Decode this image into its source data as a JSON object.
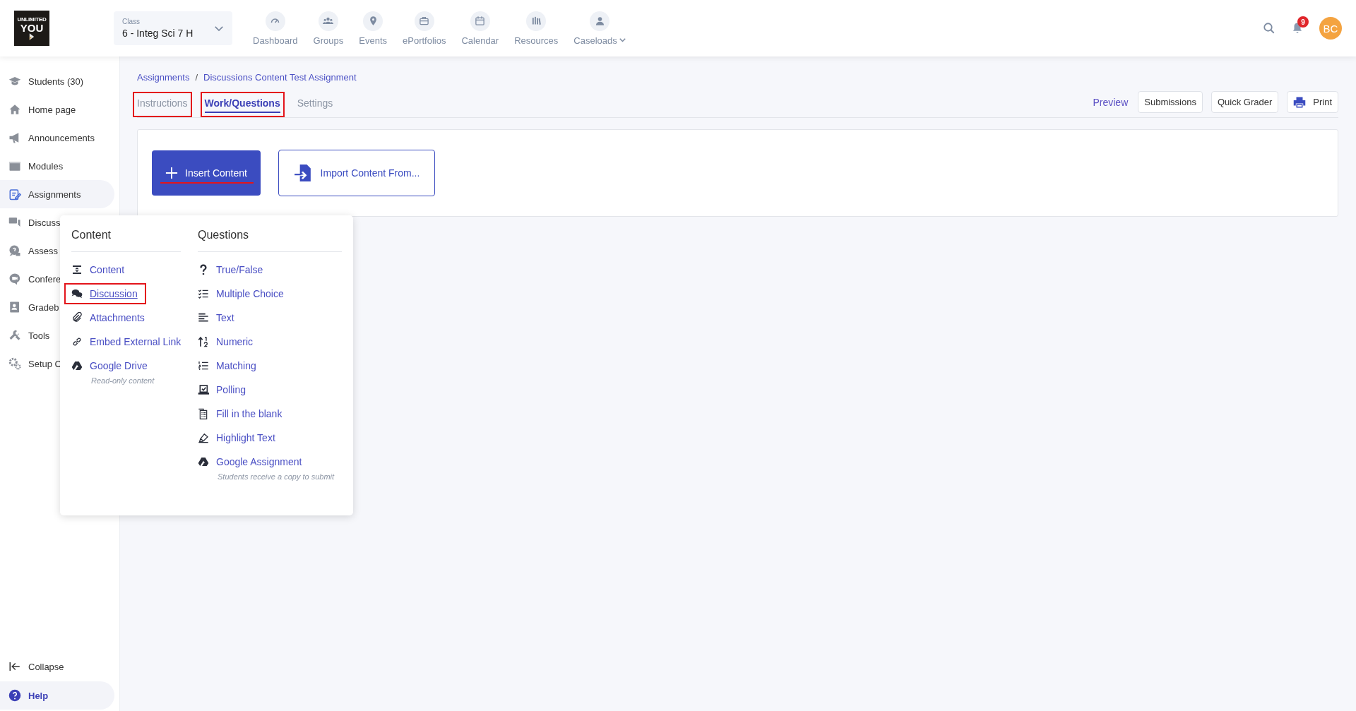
{
  "header": {
    "logo": {
      "line_1": "UNLIMITED",
      "line_2": "YOU"
    },
    "class_selector": {
      "label": "Class",
      "value": "6 - Integ Sci 7 H"
    },
    "nav": [
      {
        "label": "Dashboard",
        "has_menu": false
      },
      {
        "label": "Groups",
        "has_menu": false
      },
      {
        "label": "Events",
        "has_menu": false
      },
      {
        "label": "ePortfolios",
        "has_menu": false
      },
      {
        "label": "Calendar",
        "has_menu": false
      },
      {
        "label": "Resources",
        "has_menu": false
      },
      {
        "label": "Caseloads",
        "has_menu": true
      }
    ],
    "notification_count": "9",
    "avatar": "BC"
  },
  "sidebar": {
    "items": [
      {
        "label": "Students (30)",
        "selected": false
      },
      {
        "label": "Home page",
        "selected": false
      },
      {
        "label": "Announcements",
        "selected": false
      },
      {
        "label": "Modules",
        "selected": false
      },
      {
        "label": "Assignments",
        "selected": true
      },
      {
        "label": "Discuss",
        "selected": false
      },
      {
        "label": "Assess",
        "selected": false
      },
      {
        "label": "Confere",
        "selected": false
      },
      {
        "label": "Gradeb",
        "selected": false
      },
      {
        "label": "Tools",
        "selected": false
      },
      {
        "label": "Setup C",
        "selected": false
      }
    ],
    "collapse": "Collapse",
    "help": "Help"
  },
  "breadcrumb": {
    "items": [
      "Assignments",
      "Discussions Content Test Assignment"
    ],
    "separator": "/"
  },
  "tabs": [
    {
      "label": "Instructions",
      "selected": false,
      "annotated": true
    },
    {
      "label": "Work/Questions",
      "selected": true,
      "annotated": true
    },
    {
      "label": "Settings",
      "selected": false,
      "annotated": false
    }
  ],
  "actions": {
    "preview": "Preview",
    "buttons": [
      "Submissions",
      "Quick Grader"
    ],
    "print": "Print"
  },
  "insert_button": {
    "label": "Insert Content",
    "annotated": true
  },
  "import_button": {
    "label": "Import Content From..."
  },
  "insert_menu": {
    "columns": [
      {
        "heading": "Content",
        "items": [
          {
            "label": "Content",
            "annotated": false
          },
          {
            "label": "Discussion",
            "annotated": true
          },
          {
            "label": "Attachments",
            "annotated": false
          },
          {
            "label": "Embed External Link",
            "annotated": false
          },
          {
            "label": "Google Drive",
            "annotated": false,
            "note": "Read-only content"
          }
        ]
      },
      {
        "heading": "Questions",
        "items": [
          {
            "label": "True/False",
            "annotated": false
          },
          {
            "label": "Multiple Choice",
            "annotated": false
          },
          {
            "label": "Text",
            "annotated": false
          },
          {
            "label": "Numeric",
            "annotated": false
          },
          {
            "label": "Matching",
            "annotated": false
          },
          {
            "label": "Polling",
            "annotated": false
          },
          {
            "label": "Fill in the blank",
            "annotated": false
          },
          {
            "label": "Highlight Text",
            "annotated": false
          },
          {
            "label": "Google Assignment",
            "annotated": false,
            "note": "Students receive a copy to submit"
          }
        ]
      }
    ]
  }
}
